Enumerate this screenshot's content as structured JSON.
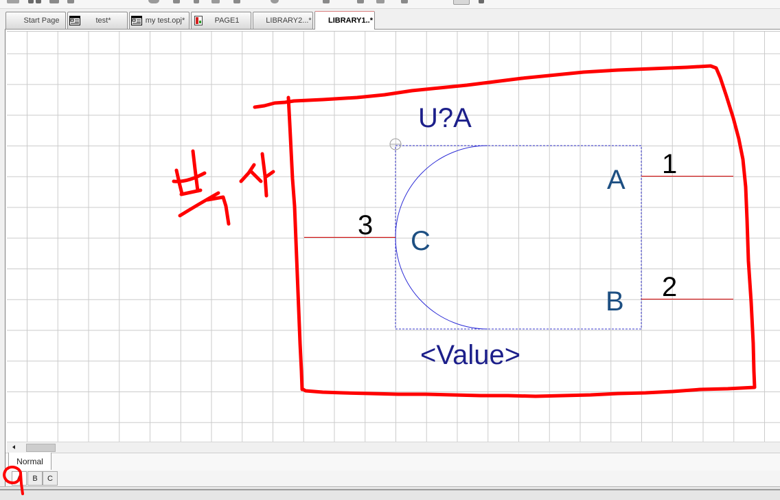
{
  "tabs": [
    {
      "label": "Start Page",
      "icon": "",
      "active": false
    },
    {
      "label": "test*",
      "icon": "schematic-page-icon",
      "active": false
    },
    {
      "label": "my test.opj*",
      "icon": "project-icon",
      "active": false
    },
    {
      "label": "PAGE1",
      "icon": "schematic-sheet-icon",
      "active": false
    },
    {
      "label": "LIBRARY2...*",
      "icon": "",
      "active": false
    },
    {
      "label": "LIBRARY1..*",
      "icon": "",
      "active": true
    }
  ],
  "part": {
    "reference": "U?A",
    "value": "<Value>",
    "pins": [
      {
        "number": "1",
        "name": "A"
      },
      {
        "number": "2",
        "name": "B"
      },
      {
        "number": "3",
        "name": "C"
      }
    ]
  },
  "package_views": [
    {
      "label": "Normal",
      "active": true
    }
  ],
  "part_sections": [
    {
      "label": "A",
      "selected": true
    },
    {
      "label": "B",
      "selected": false
    },
    {
      "label": "C",
      "selected": false
    }
  ],
  "annotations": {
    "handwritten_note": "복사"
  },
  "colors": {
    "grid": "#cbcbcb",
    "pin_line": "#d40000",
    "pin_number": "#000000",
    "pin_name": "#1d4f82",
    "part_text": "#1c1f8a",
    "part_outline": "#2b2bd6",
    "selection_box": "#3b3bd0",
    "annotation": "#ff0000"
  }
}
